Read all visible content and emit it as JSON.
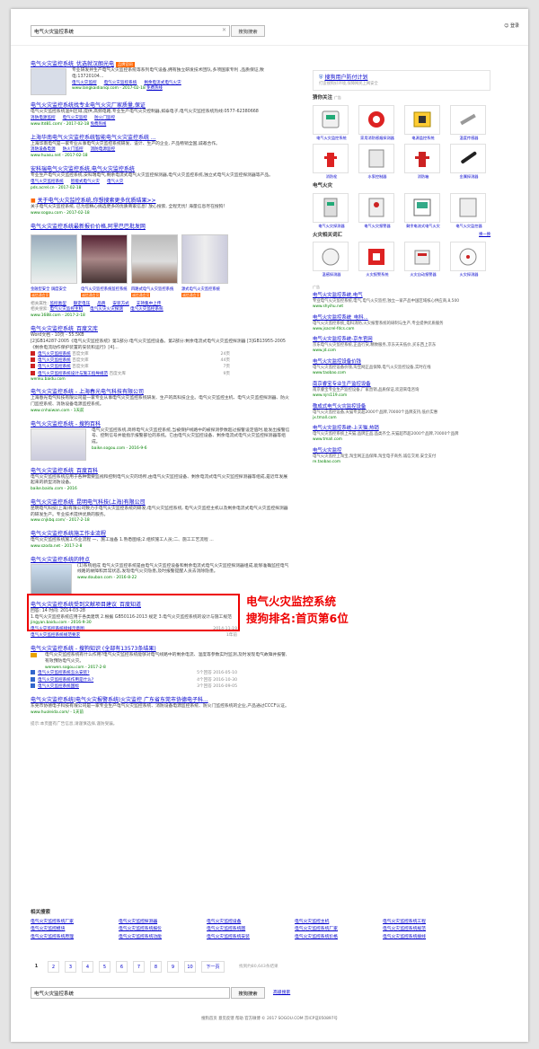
{
  "header": {
    "query": "电气火灾监控系统",
    "search_btn": "搜狗搜索",
    "login": "登录"
  },
  "results": [
    {
      "title": "电气火灾监控系统_优选就汉朗光电",
      "tag": "品牌官网",
      "desc": "专业研发并生产电气火灾监控系统等系列电气设备,拥有独立研发技术团队,多项国家专利 ,品质保证,致电:13720104...",
      "links": [
        "电气火灾监控",
        "电气火灾监控系统",
        "剩余电流式电气火灾"
      ],
      "url": "www.langkaidianqi.com - 2017-02-18",
      "extra": "免费热线"
    },
    {
      "title": "电气火灾监控系统找专业电气火灾厂家质量,保证",
      "desc": "电气火灾监控系统温州区域,提供,高频电路,专业生产电气火灾控制器,如泰电子,电气火灾监控系统热线:0577-62380668",
      "links": [
        "消防电源监控",
        "电气火灾监控",
        "防火门监控"
      ],
      "url": "www.ltd81.com/ - 2017-02-18",
      "extra": "免费热线"
    },
    {
      "title": "上海华南电气火灾监控系统智能电气火灾监控系统 ...",
      "desc": "上海华南电气是一家专业从事电气火灾监控系统研发、设计、生产的企业, 产品畅销全国,诚邀合作。",
      "links": [
        "消防设备电源",
        "防火门监控",
        "消防电源监控"
      ],
      "url": "www.huasu.net - 2017-02-18"
    },
    {
      "title": "安科瑞电气火灾监控系统,电气火灾监控系统",
      "desc": "专业生产电气火灾监控系统,安科瑞电气,剩余电流式电气火灾监控探测器,电气火灾监控系统,独立式电气火灾监控探测器等产品。",
      "links": [
        "电气火灾监控系统",
        "智能式电气火灾",
        "电气火灾"
      ],
      "url": "pds.acrel.cn - 2017-02-18"
    },
    {
      "title": "关于电气火灾监控系统,你想搜索更多优质结果>>",
      "desc": "关于电气火灾监控系统, 已为您精心挑选更多的优质商家信息! 放心搜索, 全程无忧! 海量信息尽在搜狗!",
      "url": "www.sogou.com - 2017-02-18"
    },
    {
      "title": "电气火灾监控系统最新报价价格,阿里巴巴批发网",
      "caps": [
        "金融型安全 调度安全",
        "电气火灾监控系统监控系统",
        "四路式电气火灾监控系统",
        "源式电气火灾监控系统"
      ],
      "lbl": "诚信通会员",
      "attrs": [
        "相关属性:",
        "监控类型",
        "额定电压",
        "品牌",
        "安装方式",
        "支持集中上传",
        "相关搜索:",
        "电气火灾监控主机",
        "电气火灾火灾探测",
        "电气火灾监控系统"
      ],
      "url": "www.1688.com - 2017-2-18"
    },
    {
      "title": "电气火灾监控系统_百度文库",
      "meta": "Word文档 - 10页 - 55.5KB",
      "desc": "[2]GB14287-2005《电气火灾监控系统》第1部分:电气火灾监控设备。第2部分:剩余电流式电气火灾监控探测器 [3]GB13955-2005《剩余电流动作保护装置的安装和运行》[4]...",
      "docs": [
        [
          "电气火灾监控系统",
          "百度文库",
          "24页"
        ],
        [
          "电气火灾监控系统",
          "百度文库",
          "44页"
        ],
        [
          "电气火灾监控系统",
          "百度文库",
          "7页"
        ],
        [
          "电气火灾监控系统设计与施工指导规范",
          "百度文库",
          "9页"
        ]
      ],
      "url": "wenku.baidu.com"
    },
    {
      "title": "电气火灾监控系统 - 上海春光电气科技有限公司",
      "desc": "上海春光电气科技有限公司是一家专业从事电气火灾监控系统研发、生产的高科技企业。电气火灾监控主机、电气火灾监控探测器、防火门监控系统、消防设备电源监控系统。",
      "url": "www.cnhaiwan.com - 1天前"
    },
    {
      "title": "电气火灾监控系统 - 搜狗百科",
      "desc": "电气火灾监控系统,简称电气火灾监控系统,当被保护线路中的被探测参数超过报警设定值时,能发出报警信号、控制信号并能指示报警部位的系统。它由电气火灾监控设备、剩余电流式电气火灾监控探测器等组成。",
      "url": "baike.sogou.com - 2016-9-6"
    },
    {
      "title": "电气火灾监控系统_百度百科",
      "desc": "电气火灾监控系统应用于各种需要监视和控制电气火灾的场所,由电气火灾监控设备、剩余电流式电气火灾监控探测器等组成,是近年发展起来的新型消防设备。",
      "url": "baike.baidu.com - 2016"
    },
    {
      "title": "电气火灾监控系统_昆明电气科技(上海)有限公司",
      "desc": "昆明电气科技(上海)有限公司致力于电气火灾监控系统的研发,电气火灾监控系统, 电气火灾监控主机以及剩余电流式电气火灾监控探测器的研发生产。专业技术提供优质的服务。",
      "url": "www.cnjkbq.com/ - 2017-2-18"
    },
    {
      "title": "电气火灾监控系统施工作业流程",
      "desc": "电气火灾监控系统施工作业流程 一、施工准备 1.熟悉图纸;2.组织施工人员;二、施工工艺流程 ...",
      "url": "www.szoda.net - 2017-2-8"
    },
    {
      "title": "电气火灾监控系统的特点",
      "desc": "(1)系统组成 电气火灾监控系统是由电气火灾监控设备和剩余电流式电气火灾监控探测器组成,能够准确监控电气线路的故障和异常状态,发现电气火灾隐患,及时报警提醒人员去消除隐患。",
      "url": "www.douban.com - 2016-8-22"
    },
    {
      "title": "电气火灾监控系统受到文献项目建议_百度知道",
      "meta": "回答: 14   时间: 2014-03-28",
      "desc": "1.电气火灾监控系统应用于各类建筑 2.根据 GB50116-2013 规定 3.电气火灾监控系统的设计与施工规范",
      "url": "jingyan.baidu.com - 2016-9-30",
      "docs": [
        [
          "电气火灾监控系统接线示意图",
          "",
          "2014-11-19"
        ],
        [
          "电气火灾监控系统规范要求",
          "",
          "1年前"
        ]
      ]
    },
    {
      "title": "电气火灾监控系统 - 搜狗知识 (全部有13573条结果)",
      "desc": "电气火灾监控系统有什么作用?电气火灾监控系统能够对电气线路中的剩余电流、温度等参数实时监测,及时发现电气故障并报警,有效预防电气火灾。",
      "url": "wenwen.sogou.com - 2017-2-8",
      "docs": [
        [
          "电气火灾监控系统怎么安装?",
          "5个回答",
          "2016-05-10"
        ],
        [
          "电气火灾监控系统作用是什么?",
          "4个回答",
          "2016-10-30"
        ],
        [
          "电气火灾监控系统国标",
          "3个回答",
          "2016-09-05"
        ]
      ]
    },
    {
      "title": "电气火灾监控系统|电气火灾报警系统|火灾监控 广东省东莞市协德电子科...",
      "desc": "东莞市协德电子科技有限公司是一家专业生产电气火灾监控系统、消防设备电源监控系统、防火门监控系统的企业,产品通过CCCF认证。",
      "url": "www.huoleida.com/ - 1天前"
    }
  ],
  "tip": "提示:本页面有广告信息,请谨慎选择,谨防受骗。",
  "annotation": {
    "line1": "电气火灾监控系统",
    "line2": "搜狗排名:首页第6位"
  },
  "related": {
    "title": "相关搜索",
    "items": [
      "电气火灾监控系统厂家",
      "电气火灾监控探测器",
      "电气火灾监控设备",
      "电气火灾监控主机",
      "电气火灾监控系统工程",
      "电气火灾监控模块",
      "电气火灾监控系统报价",
      "电气火灾监控系统图",
      "电气火灾监控系统厂家",
      "电气火灾监控系统规范",
      "电气火灾监控系统原理",
      "电气火灾监控系统功能",
      "电气火灾监控系统安装",
      "电气火灾监控系统价格",
      "电气火灾监控系统接线"
    ]
  },
  "pager": {
    "pages": [
      "1",
      "2",
      "3",
      "4",
      "5",
      "6",
      "7",
      "8",
      "9",
      "10"
    ],
    "next": "下一页",
    "count": "找到约80,643条结果"
  },
  "adv": "高级搜索",
  "footer": "搜狗首页  意见反馈  帮助  官方微博  © 2017 SOGOU.COM  京ICP证050897号",
  "right": {
    "box": {
      "title": "搜狗用户防付计划",
      "desc": "打造搜狗好环境,保障网民上网安全"
    },
    "s1": {
      "title": "猜你关注",
      "items": [
        "电气火灾监控系统",
        "家用消防感烟探测器",
        "电源监控系统",
        "温度传感器",
        "消防栓",
        "水泵控制器",
        "消防箱",
        "金属探测器"
      ]
    },
    "s2": {
      "title": "电气火灾",
      "items": [
        "电气火灾探测器",
        "电气火灾报警器",
        "剩余电流式电气火灾",
        "电气火灾监控器"
      ]
    },
    "s3": {
      "title": "火灾相关词汇",
      "more": "换一换",
      "items": [
        "温感探测器",
        "火灾报警系统",
        "火灾自动报警器",
        "火灾探测器"
      ]
    },
    "adlabel": "广告",
    "ads": [
      {
        "t": "电气火灾监控系统,电气",
        "b": "专业电气火灾监控系统,电气,电气火灾监控,独立一家产品中国区域核心供应商,8,500",
        "u": "www.shyihu.net"
      },
      {
        "t": "电气火灾监控系统_电科...",
        "b": "电气火灾监控系统_电科消防,火灾报警系统的研制与生产,专业提供优质服务",
        "u": "www.jsacrel-fdcs.com"
      },
      {
        "t": "电气火灾监控系统-京东官网",
        "b": "京东电气火灾监控系统,正品行货,精致服务,京东天天低价,买东西上京东",
        "u": "www.jd.com"
      },
      {
        "t": "电气火灾监控设备价钱",
        "b": "电气火灾监控设备价钱,淘宝网正品保障,电气火灾监控设备,实时在线",
        "u": "www.taobao.com"
      },
      {
        "t": "南京睿宝专业生产监控设备",
        "b": "南京睿宝专业生产监控设备,厂家直销,品质保证,欢迎来电咨询",
        "u": "www.njrs119.com"
      },
      {
        "t": "敬成式电气火灾监控设备",
        "b": "电气火灾监控设备,天猫专卖超2000个品牌,70000个品牌支持,低价实惠",
        "u": "jx.tmall.com"
      },
      {
        "t": "电气火灾监控系统-上天猫,热销",
        "b": "电气火灾监控系统上天猫,品牌正品,品类齐全,天猫超市超2000个品牌,70000个品牌",
        "u": "www.tmall.com"
      },
      {
        "t": "电气火灾监控",
        "b": "电气火灾监控上淘宝,淘宝网正品保障,淘宝电子商务,诚信交易,安全支付",
        "u": "re.taobao.com"
      }
    ]
  },
  "colors": {
    "link": "#0000cc",
    "url": "#008000",
    "highlight": "#ee0000",
    "tag": "#ff6600"
  }
}
